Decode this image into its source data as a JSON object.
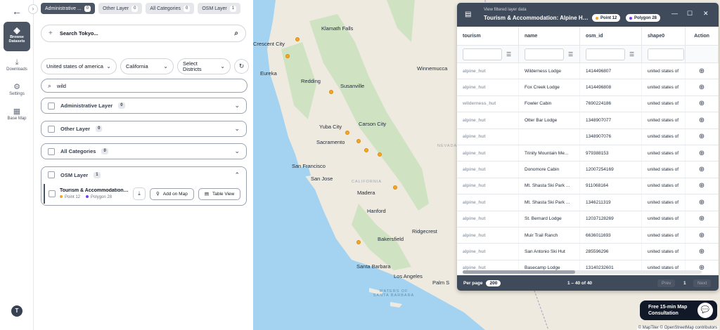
{
  "rail": {
    "browse_label": "Browse Datasets",
    "items": [
      {
        "label": "Downloads",
        "icon": "download-icon"
      },
      {
        "label": "Settings",
        "icon": "gear-icon"
      },
      {
        "label": "Base Map",
        "icon": "map-icon"
      }
    ],
    "avatar": "T"
  },
  "tabs": [
    {
      "label": "Administrative ...",
      "count": "0"
    },
    {
      "label": "Other Layer",
      "count": "0"
    },
    {
      "label": "All Categories",
      "count": "0"
    },
    {
      "label": "OSM Layer",
      "count": "1"
    }
  ],
  "search": {
    "placeholder": "Search Tokyo..."
  },
  "filters": {
    "country": "United states of america",
    "state": "California",
    "district": "Select Districts"
  },
  "layer_search": {
    "value": "wild"
  },
  "layers": [
    {
      "label": "Administrative Layer",
      "count": "0"
    },
    {
      "label": "Other Layer",
      "count": "0"
    },
    {
      "label": "All Categories",
      "count": "0"
    }
  ],
  "osm": {
    "label": "OSM Layer",
    "count": "1",
    "sublayer": {
      "name": "Tourism & Accommodation: ...",
      "point": "Point 12",
      "polygon": "Polygon 28",
      "add_label": "Add on Map",
      "table_label": "Table View"
    }
  },
  "map": {
    "labels": [
      {
        "text": "Klamath Falls",
        "kind": "city"
      },
      {
        "text": "Crescent City",
        "kind": "city"
      },
      {
        "text": "Eureka",
        "kind": "city"
      },
      {
        "text": "Redding",
        "kind": "city"
      },
      {
        "text": "Susanville",
        "kind": "city"
      },
      {
        "text": "Winnemucca",
        "kind": "city"
      },
      {
        "text": "Yuba City",
        "kind": "city"
      },
      {
        "text": "Carson City",
        "kind": "city"
      },
      {
        "text": "Sacramento",
        "kind": "city"
      },
      {
        "text": "NEVADA",
        "kind": "state"
      },
      {
        "text": "San Francisco",
        "kind": "city"
      },
      {
        "text": "San Jose",
        "kind": "city"
      },
      {
        "text": "CALIFORNIA",
        "kind": "state"
      },
      {
        "text": "Madera",
        "kind": "city"
      },
      {
        "text": "Hanford",
        "kind": "city"
      },
      {
        "text": "Ridgecrest",
        "kind": "city"
      },
      {
        "text": "Bakersfield",
        "kind": "city"
      },
      {
        "text": "Santa Barbara",
        "kind": "city"
      },
      {
        "text": "Los Angeles",
        "kind": "city"
      },
      {
        "text": "Palm S",
        "kind": "city"
      },
      {
        "text": "WATERS OF SANTA BARBARA",
        "kind": "sea"
      }
    ],
    "attribution": "© MapTiler © OpenStreetMap contributors",
    "marker_color": "#f5a623"
  },
  "table": {
    "subtitle": "View filtered layer data",
    "title": "Tourism & Accommodation: Alpine Hut / ...",
    "chip_point": "Point 12",
    "chip_polygon": "Polygon 28",
    "columns": [
      "tourism",
      "name",
      "osm_id",
      "shape0",
      "Action"
    ],
    "rows": [
      [
        "alpine_hut",
        "Wilderness Lodge",
        "1414496807",
        "united states of"
      ],
      [
        "alpine_hut",
        "Fox Creek Lodge",
        "1414496808",
        "united states of"
      ],
      [
        "wilderness_hut",
        "Fowler Cabin",
        "7690224186",
        "united states of"
      ],
      [
        "alpine_hut",
        "Otter Bar Lodge",
        "1348907077",
        "united states of"
      ],
      [
        "alpine_hut",
        "",
        "1348907076",
        "united states of"
      ],
      [
        "alpine_hut",
        "Trinity Mountain Me...",
        "979388153",
        "united states of"
      ],
      [
        "alpine_hut",
        "Donomore Cabin",
        "12007254169",
        "united states of"
      ],
      [
        "alpine_hut",
        "Mt. Shasta Ski Park ...",
        "911068164",
        "united states of"
      ],
      [
        "alpine_hut",
        "Mt. Shasta Ski Park ...",
        "1346211319",
        "united states of"
      ],
      [
        "alpine_hut",
        "St. Bernard Lodge",
        "12037128269",
        "united states of"
      ],
      [
        "alpine_hut",
        "Muir Trail Ranch",
        "6636011693",
        "united states of"
      ],
      [
        "alpine_hut",
        "San Antonio Ski Hut",
        "285596296",
        "united states of"
      ],
      [
        "alpine_hut",
        "Basecamp Lodge",
        "13140232601",
        "united states of"
      ]
    ],
    "per_page_label": "Per page",
    "per_page": "200",
    "range": "1 – 40 of 40",
    "prev": "Prev",
    "page": "1",
    "next": "Next"
  },
  "consult": {
    "label": "Free 15-min Map Consultation"
  }
}
